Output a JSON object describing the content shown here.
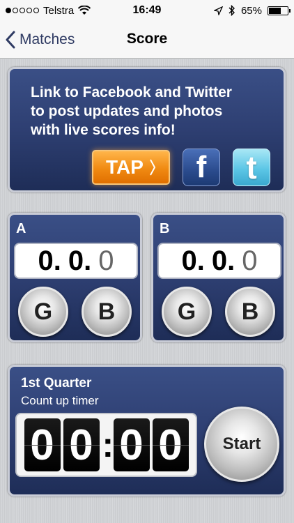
{
  "status_bar": {
    "carrier": "Telstra",
    "time": "16:49",
    "battery": "65%",
    "battery_level": 0.65,
    "signal_bars": 1
  },
  "nav": {
    "back_label": "Matches",
    "title": "Score"
  },
  "promo": {
    "line1": "Link to Facebook and Twitter",
    "line2": "to post updates and photos",
    "line3": "with live scores info!",
    "tap_label": "TAP",
    "facebook_glyph": "f",
    "twitter_glyph": "t"
  },
  "teams": [
    {
      "name": "A",
      "goals": "0.",
      "behinds_dot": "0.",
      "total": "0",
      "goal_button": "G",
      "behind_button": "B"
    },
    {
      "name": "B",
      "goals": "0.",
      "behinds_dot": "0.",
      "total": "0",
      "goal_button": "G",
      "behind_button": "B"
    }
  ],
  "timer": {
    "quarter": "1st Quarter",
    "mode": "Count up timer",
    "digits": [
      "0",
      "0",
      "0",
      "0"
    ],
    "separator": ":",
    "start_label": "Start"
  },
  "colors": {
    "panel_blue": "#2e3f72",
    "tap_orange": "#f08a12",
    "facebook_blue": "#2a4b8d",
    "twitter_blue": "#5cc6e6"
  },
  "icons": {
    "back": "chevron-left-icon",
    "wifi": "wifi-icon",
    "location": "location-arrow-icon",
    "bluetooth": "bluetooth-icon",
    "battery": "battery-icon"
  }
}
